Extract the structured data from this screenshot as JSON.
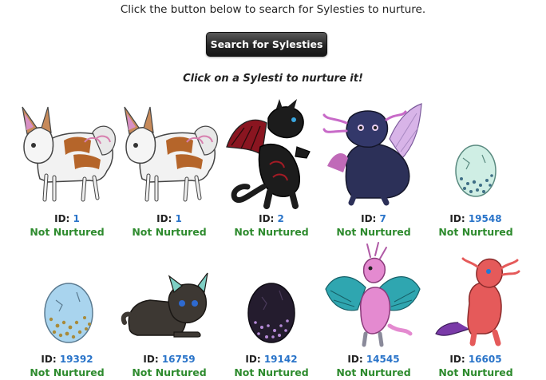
{
  "intro_text": "Click the button below to search for Sylesties to nurture.",
  "search_button_label": "Search for Sylesties",
  "instruction_text": "Click on a Sylesti to nurture it!",
  "id_prefix": "ID:",
  "colors": {
    "id_link": "#2a74c9",
    "status_text": "#2e8b2e",
    "button_bg": "#262626"
  },
  "sylesties": [
    {
      "id": "1",
      "status": "Not Nurtured",
      "icon": "brown-white-fox-sylesti"
    },
    {
      "id": "1",
      "status": "Not Nurtured",
      "icon": "brown-white-fox-sylesti"
    },
    {
      "id": "2",
      "status": "Not Nurtured",
      "icon": "black-red-dragon-sylesti"
    },
    {
      "id": "7",
      "status": "Not Nurtured",
      "icon": "navy-winged-axolotl-sylesti"
    },
    {
      "id": "19548",
      "status": "Not Nurtured",
      "icon": "mint-speckled-egg"
    },
    {
      "id": "19392",
      "status": "Not Nurtured",
      "icon": "blue-gold-speckled-egg"
    },
    {
      "id": "16759",
      "status": "Not Nurtured",
      "icon": "dark-cat-sylesti"
    },
    {
      "id": "19142",
      "status": "Not Nurtured",
      "icon": "dark-purple-speckled-egg"
    },
    {
      "id": "14545",
      "status": "Not Nurtured",
      "icon": "pink-teal-winged-sylesti"
    },
    {
      "id": "16605",
      "status": "Not Nurtured",
      "icon": "red-sea-dragon-sylesti"
    }
  ]
}
